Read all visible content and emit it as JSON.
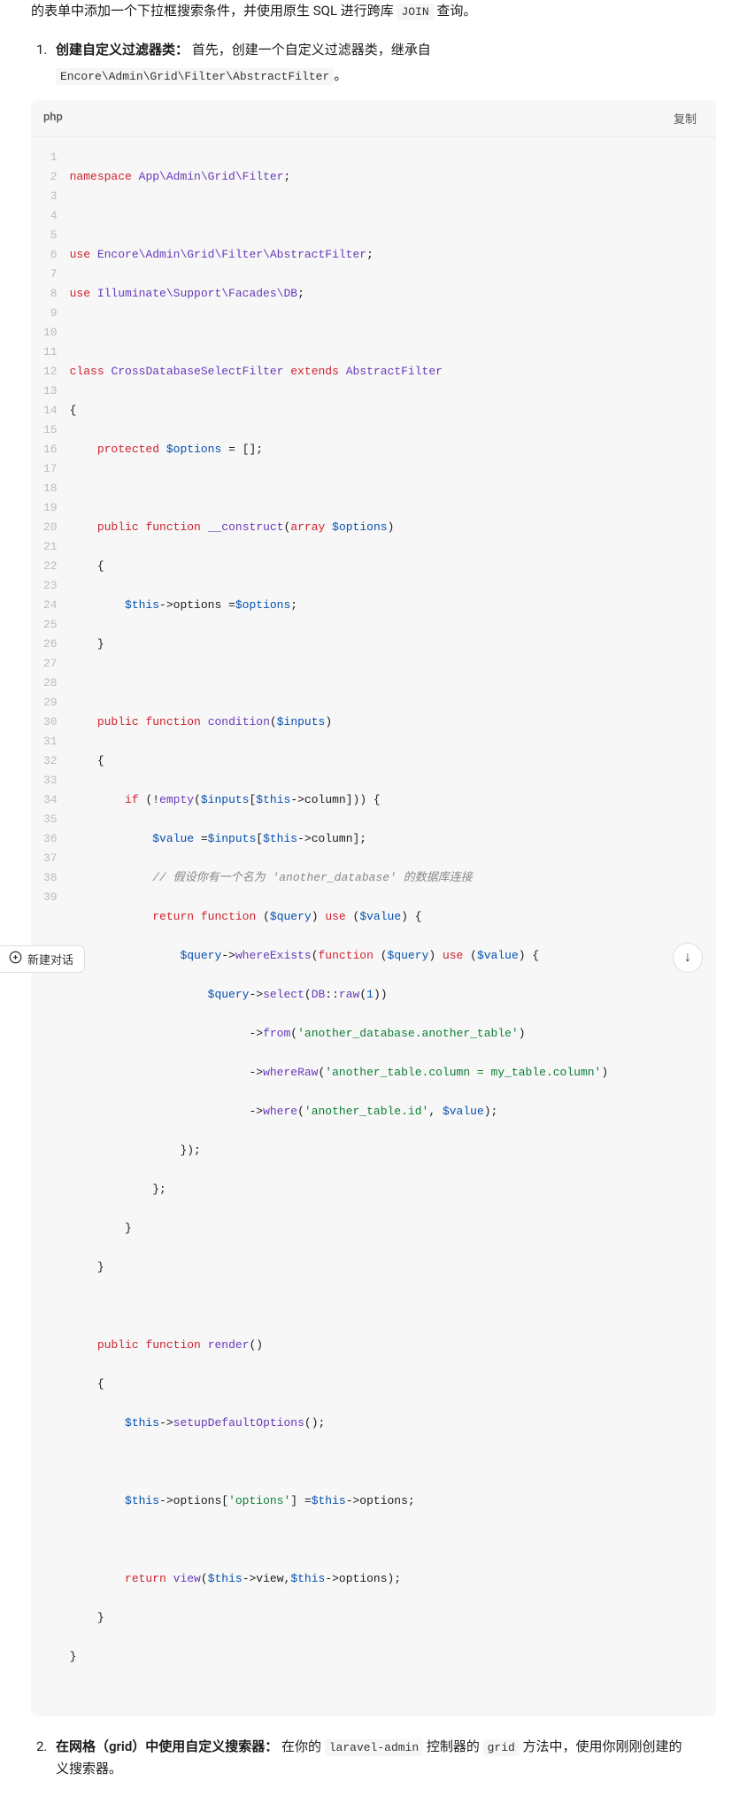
{
  "intro": {
    "prefix": "的表单中添加一个下拉框搜索条件，并使用原生 SQL 进行跨库 ",
    "code": "JOIN",
    "suffix": " 查询。"
  },
  "step1": {
    "num": "1",
    "title": "创建自定义过滤器类：",
    "desc_prefix": " 首先，创建一个自定义过滤器类，继承自 ",
    "desc_code": "Encore\\Admin\\Grid\\Filter\\AbstractFilter",
    "desc_suffix": "。"
  },
  "code_block": {
    "lang": "php",
    "copy_label": "复制",
    "line_numbers": [
      "1",
      "2",
      "3",
      "4",
      "5",
      "6",
      "7",
      "8",
      "9",
      "10",
      "11",
      "12",
      "13",
      "14",
      "15",
      "16",
      "17",
      "18",
      "19",
      "20",
      "21",
      "22",
      "23",
      "24",
      "25",
      "26",
      "27",
      "28",
      "29",
      "30",
      "31",
      "32",
      "33",
      "34",
      "35",
      "36",
      "37",
      "38",
      "39"
    ]
  },
  "code": {
    "l1": {
      "kw1": "namespace",
      "ns": "App\\Admin\\Grid\\Filter",
      "sc": ";"
    },
    "l3": {
      "kw": "use",
      "ns": "Encore\\Admin\\Grid\\Filter\\AbstractFilter",
      "sc": ";"
    },
    "l4": {
      "kw": "use",
      "ns": "Illuminate\\Support\\Facades\\DB",
      "sc": ";"
    },
    "l6": {
      "kw1": "class",
      "cls": "CrossDatabaseSelectFilter",
      "kw2": "extends",
      "parent": "AbstractFilter"
    },
    "l7": {
      "brace": "{"
    },
    "l8": {
      "kw": "protected",
      "var": "$options",
      "op": "= [];"
    },
    "l10": {
      "kw1": "public",
      "kw2": "function",
      "fn": "__construct",
      "sig_open": "(",
      "kw3": "array",
      "var": "$options",
      "sig_close": ")"
    },
    "l11": {
      "brace": "{"
    },
    "l12": {
      "var": "$this",
      "arrow": "->options =",
      "var2": "$options",
      "sc": ";"
    },
    "l13": {
      "brace": "}"
    },
    "l15": {
      "kw1": "public",
      "kw2": "function",
      "fn": "condition",
      "sig_open": "(",
      "var": "$inputs",
      "sig_close": ")"
    },
    "l16": {
      "brace": "{"
    },
    "l17": {
      "kw": "if",
      "open": " (!",
      "fn": "empty",
      "p1": "(",
      "var": "$inputs",
      "br": "[",
      "var2": "$this",
      "arrow": "->column])) {"
    },
    "l18": {
      "var": "$value",
      "eq": " =",
      "var2": "$inputs",
      "br": "[",
      "var3": "$this",
      "arrow": "->column];"
    },
    "l19": {
      "comment": "// 假设你有一个名为 'another_database' 的数据库连接"
    },
    "l20": {
      "kw": "return",
      "kw2": "function",
      "open": " (",
      "var": "$query",
      "close": ") ",
      "kw3": "use",
      "open2": " (",
      "var2": "$value",
      "close2": ") {"
    },
    "l21": {
      "var": "$query",
      "arrow": "->",
      "meth": "whereExists",
      "open": "(",
      "kw": "function",
      "open2": " (",
      "var2": "$query",
      "close": ") ",
      "kw2": "use",
      "open3": " (",
      "var3": "$value",
      "close3": ") {"
    },
    "l22": {
      "var": "$query",
      "arrow": "->",
      "meth": "select",
      "open": "(",
      "cls": "DB",
      "sc": "::",
      "fn": "raw",
      "open2": "(",
      "num": "1",
      "close": "))"
    },
    "l23": {
      "arrow": "->",
      "meth": "from",
      "open": "(",
      "str": "'another_database.another_table'",
      "close": ")"
    },
    "l24": {
      "arrow": "->",
      "meth": "whereRaw",
      "open": "(",
      "str": "'another_table.column = my_table.column'",
      "close": ")"
    },
    "l25": {
      "arrow": "->",
      "meth": "where",
      "open": "(",
      "str": "'another_table.id'",
      "comma": ", ",
      "var": "$value",
      "close": ");"
    },
    "l26": {
      "close": "});"
    },
    "l27": {
      "close": "};"
    },
    "l28": {
      "brace": "}"
    },
    "l29": {
      "brace": "}"
    },
    "l31": {
      "kw1": "public",
      "kw2": "function",
      "fn": "render",
      "sig": "()"
    },
    "l32": {
      "brace": "{"
    },
    "l33": {
      "var": "$this",
      "arrow": "->",
      "meth": "setupDefaultOptions",
      "call": "();"
    },
    "l35": {
      "var": "$this",
      "arrow": "->options[",
      "str": "'options'",
      "br": "] =",
      "var2": "$this",
      "arrow2": "->options;"
    },
    "l37": {
      "kw": "return",
      "fn": "view",
      "open": "(",
      "var": "$this",
      "arrow": "->view,",
      "var2": "$this",
      "arrow2": "->options);"
    },
    "l38": {
      "brace": "}"
    },
    "l39": {
      "brace": "}"
    }
  },
  "step2": {
    "num": "2",
    "title": "在网格（grid）中使用自定义搜索器：",
    "part1": " 在你的 ",
    "code1": "laravel-admin",
    "part2": " 控制器的 ",
    "code2": "grid",
    "part3": " 方法中，使用你刚刚创建的",
    "line2": "义搜索器。"
  },
  "bottom": {
    "new_chat": "新建对话"
  }
}
